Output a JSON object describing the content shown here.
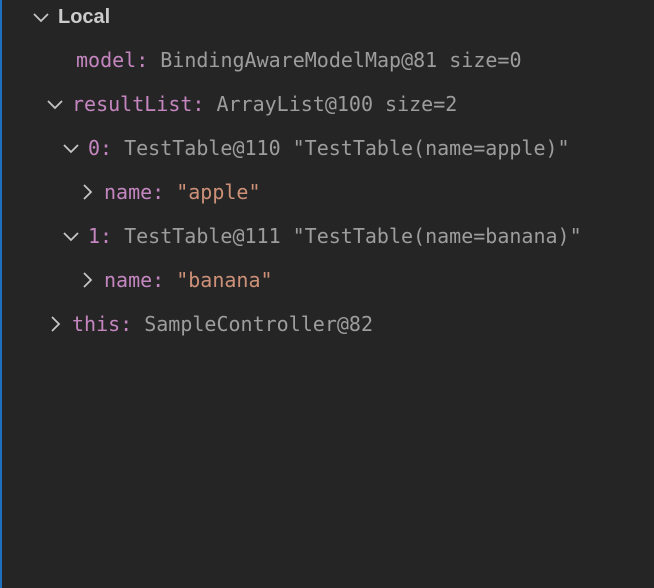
{
  "section": {
    "title": "Local"
  },
  "rows": [
    {
      "key": "model",
      "value": "BindingAwareModelMap@81 size=0"
    },
    {
      "key": "resultList",
      "value": "ArrayList@100 size=2"
    },
    {
      "key": "0",
      "type": "TestTable@110",
      "str": "\"TestTable(name=apple)\""
    },
    {
      "key": "name",
      "str": "\"apple\""
    },
    {
      "key": "1",
      "type": "TestTable@111",
      "str": "\"TestTable(name=banana)\""
    },
    {
      "key": "name",
      "str": "\"banana\""
    },
    {
      "key": "this",
      "value": "SampleController@82"
    }
  ],
  "colors": {
    "background": "#252526",
    "key": "#c586c0",
    "type_value": "#9d9d9d",
    "string_value": "#ce9178",
    "focus_border": "#1f6fbf"
  },
  "icons": {
    "expanded": "chevron-down-icon",
    "collapsed": "chevron-right-icon"
  }
}
